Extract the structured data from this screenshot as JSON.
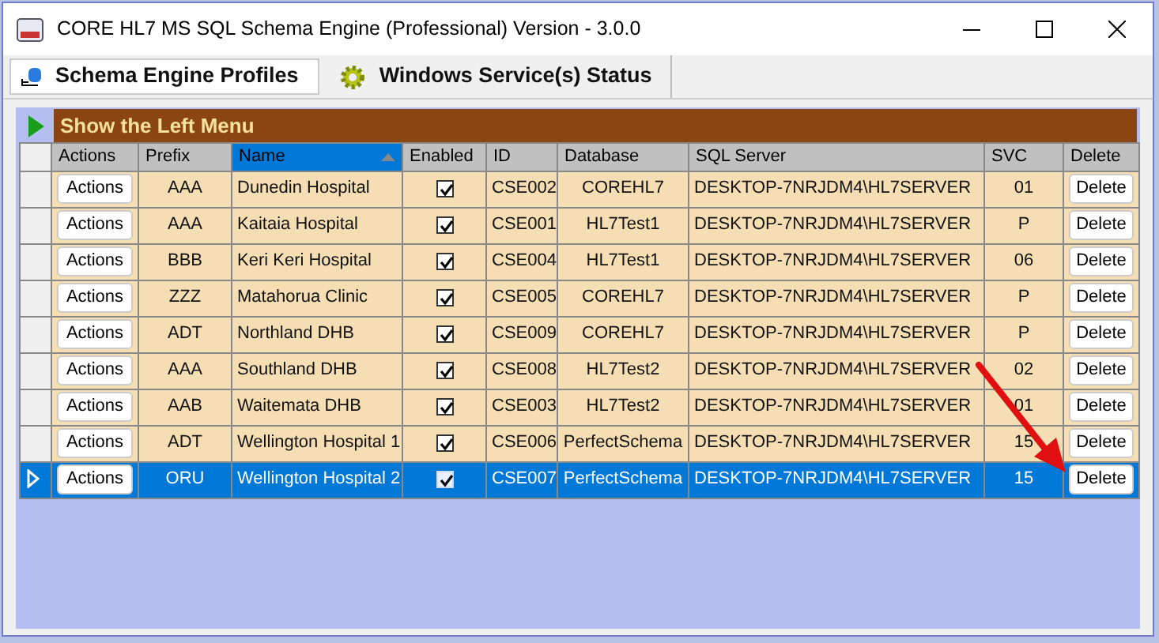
{
  "window": {
    "title": "CORE HL7 MS SQL Schema Engine (Professional) Version - 3.0.0"
  },
  "tabs": [
    {
      "label": "Schema Engine Profiles",
      "selected": true
    },
    {
      "label": "Windows Service(s) Status",
      "selected": false
    }
  ],
  "left_menu": {
    "label": "Show the Left Menu"
  },
  "table": {
    "columns": [
      {
        "label": "Actions",
        "sorted": false
      },
      {
        "label": "Prefix",
        "sorted": false
      },
      {
        "label": "Name",
        "sorted": true
      },
      {
        "label": "Enabled",
        "sorted": false
      },
      {
        "label": "ID",
        "sorted": false
      },
      {
        "label": "Database",
        "sorted": false
      },
      {
        "label": "SQL Server",
        "sorted": false
      },
      {
        "label": "SVC",
        "sorted": false
      },
      {
        "label": "Delete",
        "sorted": false
      }
    ],
    "rows": [
      {
        "selected": false,
        "action": "Actions",
        "prefix": "AAA",
        "name": "Dunedin Hospital",
        "enabled": true,
        "id": "CSE002",
        "database": "COREHL7",
        "sql_server": "DESKTOP-7NRJDM4\\HL7SERVER",
        "svc": "01",
        "delete": "Delete"
      },
      {
        "selected": false,
        "action": "Actions",
        "prefix": "AAA",
        "name": "Kaitaia Hospital",
        "enabled": true,
        "id": "CSE001",
        "database": "HL7Test1",
        "sql_server": "DESKTOP-7NRJDM4\\HL7SERVER",
        "svc": "P",
        "delete": "Delete"
      },
      {
        "selected": false,
        "action": "Actions",
        "prefix": "BBB",
        "name": "Keri Keri Hospital",
        "enabled": true,
        "id": "CSE004",
        "database": "HL7Test1",
        "sql_server": "DESKTOP-7NRJDM4\\HL7SERVER",
        "svc": "06",
        "delete": "Delete"
      },
      {
        "selected": false,
        "action": "Actions",
        "prefix": "ZZZ",
        "name": "Matahorua Clinic",
        "enabled": true,
        "id": "CSE005",
        "database": "COREHL7",
        "sql_server": "DESKTOP-7NRJDM4\\HL7SERVER",
        "svc": "P",
        "delete": "Delete"
      },
      {
        "selected": false,
        "action": "Actions",
        "prefix": "ADT",
        "name": "Northland DHB",
        "enabled": true,
        "id": "CSE009",
        "database": "COREHL7",
        "sql_server": "DESKTOP-7NRJDM4\\HL7SERVER",
        "svc": "P",
        "delete": "Delete"
      },
      {
        "selected": false,
        "action": "Actions",
        "prefix": "AAA",
        "name": "Southland DHB",
        "enabled": true,
        "id": "CSE008",
        "database": "HL7Test2",
        "sql_server": "DESKTOP-7NRJDM4\\HL7SERVER",
        "svc": "02",
        "delete": "Delete"
      },
      {
        "selected": false,
        "action": "Actions",
        "prefix": "AAB",
        "name": "Waitemata DHB",
        "enabled": true,
        "id": "CSE003",
        "database": "HL7Test2",
        "sql_server": "DESKTOP-7NRJDM4\\HL7SERVER",
        "svc": "01",
        "delete": "Delete"
      },
      {
        "selected": false,
        "action": "Actions",
        "prefix": "ADT",
        "name": "Wellington Hospital 1",
        "enabled": true,
        "id": "CSE006",
        "database": "PerfectSchema",
        "sql_server": "DESKTOP-7NRJDM4\\HL7SERVER",
        "svc": "15",
        "delete": "Delete"
      },
      {
        "selected": true,
        "action": "Actions",
        "prefix": "ORU",
        "name": "Wellington Hospital 2",
        "enabled": true,
        "id": "CSE007",
        "database": "PerfectSchema",
        "sql_server": "DESKTOP-7NRJDM4\\HL7SERVER",
        "svc": "15",
        "delete": "Delete"
      }
    ]
  }
}
